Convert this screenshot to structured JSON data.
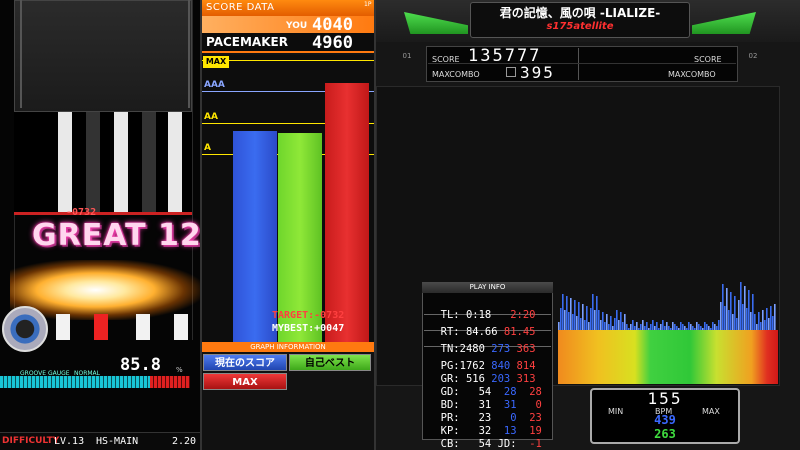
{
  "lane": {
    "judge_combo_small": "-0732",
    "judge_text": "GREAT 12",
    "gauge_value": "85.8",
    "gauge_percent": "%",
    "gauge_label": "GROOVE GAUGE",
    "gauge_mode": "NORMAL",
    "gauge_fill_pct": 85.8
  },
  "footer": {
    "play_mode": "DIFFICULTY",
    "level": "LV.13",
    "hs_label": "HS-MAIN",
    "hs_value": "2.20"
  },
  "score_data": {
    "header": "SCORE DATA",
    "side": "1P",
    "you_label": "YOU",
    "you_score": "4040",
    "pacemaker_label": "PACEMAKER",
    "pacemaker_score": "4960",
    "grade_max": "MAX",
    "grade_aaa": "AAA",
    "grade_aa": "AA",
    "grade_a": "A",
    "target_text": "TARGET:-0732",
    "mybest_text": "MYBEST:+0047",
    "graph_info": "GRAPH INFORMATION",
    "btn_now": "現在のスコア",
    "btn_best": "自己ベスト",
    "btn_max": "MAX"
  },
  "graph_chart": {
    "max_score": 5400,
    "grade_lines": [
      5400,
      4800,
      4200,
      3600
    ],
    "bars": {
      "you": 4040,
      "mybest": 4005,
      "pacemaker": 4960
    }
  },
  "header": {
    "song_title": "君の記憶、風の唄 -LIALIZE-",
    "artist": "s175atellite"
  },
  "score_panel": {
    "p1_tag": "01",
    "p2_tag": "02",
    "score_label": "SCORE",
    "score_value": "135777",
    "maxcombo_label": "MAXCOMBO",
    "maxcombo_value": "395",
    "score_label_r": "SCORE",
    "maxcombo_label_r": "MAXCOMBO"
  },
  "play_info": {
    "header": "PLAY INFO",
    "tl": {
      "label": "TL:",
      "value": "0:18",
      "total": "2:20"
    },
    "rt": {
      "label": "RT:",
      "value": "84.66",
      "pct": "81.45"
    },
    "tn": {
      "label": "TN:",
      "value": "2480",
      "blue": "273",
      "red": "363"
    },
    "pg": {
      "label": "PG:",
      "value": "1762",
      "blue": "840",
      "red": "814"
    },
    "gr": {
      "label": "GR:",
      "value": "516",
      "blue": "203",
      "red": "313"
    },
    "gd": {
      "label": "GD:",
      "value": "54",
      "blue": "28",
      "red": "28"
    },
    "bd": {
      "label": "BD:",
      "value": "31",
      "blue": "31",
      "red": "0"
    },
    "pr": {
      "label": "PR:",
      "value": "23",
      "blue": "0",
      "red": "23"
    },
    "kp": {
      "label": "KP:",
      "value": "32",
      "blue": "13",
      "red": "19"
    },
    "cb": {
      "label": "CB:",
      "value": "54",
      "jd_label": "JD:",
      "jd_value": "-1"
    }
  },
  "bpm": {
    "current": "155",
    "min_label": "MIN",
    "bpm_label": "BPM",
    "max_label": "MAX",
    "max_value": "439",
    "min_value": "263"
  },
  "colors": {
    "you_bar": "#3a6cf0",
    "mybest_bar": "#8fe838",
    "pacemaker_bar": "#e83030",
    "accent": "#ff7a10"
  }
}
